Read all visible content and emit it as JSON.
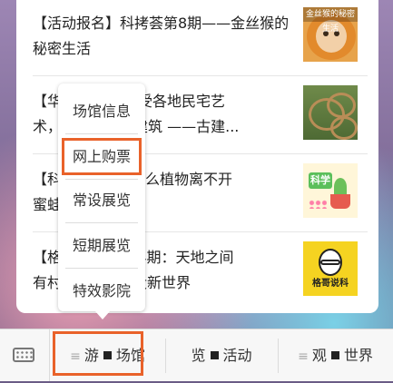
{
  "articles": [
    {
      "title": "【活动报名】科拷荟第8期——金丝猴的秘密生活",
      "thumb_label": "金丝猴的秘密生活"
    },
    {
      "title": "【华...】感受各地民宅艺术，...代建筑 ——古建..."
    },
    {
      "title": "【科...为什么植物离不开蜜蜂..."
    },
    {
      "title": "【格...234期：天地之间有村...没新世界",
      "thumb_label": "格哥说科"
    }
  ],
  "article_fragments": {
    "a2_line1_start": "【华",
    "a2_line1_end": "】感受各地民宅艺",
    "a2_line2_start": "术，",
    "a2_line2_end": "代建筑 ——古建...",
    "a3_line1_start": "【科",
    "a3_line1_end": "为什么植物离不开",
    "a3_line2_start": "蜜蛙",
    "a4_line1_start": "【格",
    "a4_line1_end": "234期：天地之间",
    "a4_line2_start": "有村",
    "a4_line2_end": "没新世界"
  },
  "thumb3_sign": "科学",
  "popup_menu": {
    "items": [
      "场馆信息",
      "网上购票",
      "常设展览",
      "短期展览",
      "特效影院"
    ],
    "highlighted_index": 1
  },
  "bottom_menu": {
    "items": [
      {
        "prefix": "≡",
        "left": "游",
        "right": "场馆"
      },
      {
        "prefix": "",
        "left": "览",
        "right": "活动"
      },
      {
        "prefix": "≡",
        "left": "观",
        "right": "世界"
      }
    ]
  },
  "colors": {
    "highlight": "#e9622a",
    "card": "#ffffff",
    "bar": "#f7f7f7"
  }
}
